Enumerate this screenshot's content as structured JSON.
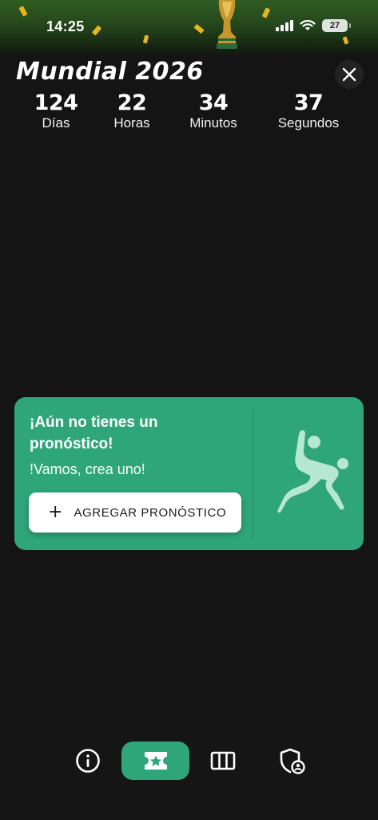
{
  "status_bar": {
    "time": "14:25",
    "battery": "27",
    "icons": [
      "signal-icon",
      "wifi-icon",
      "battery-icon"
    ]
  },
  "header": {
    "title": "Mundial 2026",
    "close_icon": "close-icon"
  },
  "countdown": {
    "days": {
      "value": "124",
      "label": "Días"
    },
    "hours": {
      "value": "22",
      "label": "Horas"
    },
    "minutes": {
      "value": "34",
      "label": "Minutos"
    },
    "seconds": {
      "value": "37",
      "label": "Segundos"
    }
  },
  "prediction_card": {
    "title": "¡Aún no tienes un pronóstico!",
    "subtitle": "!Vamos, crea uno!",
    "button_icon": "+",
    "button_label": "AGREGAR PRONÓSTICO",
    "illustration": "bicycle-kick-player-icon"
  },
  "bottom_nav": {
    "items": [
      {
        "icon": "info-icon",
        "active": false
      },
      {
        "icon": "ticket-star-icon",
        "active": true
      },
      {
        "icon": "columns-icon",
        "active": false
      },
      {
        "icon": "shield-user-icon",
        "active": false
      }
    ]
  },
  "colors": {
    "background": "#141414",
    "accent": "#2fa67a",
    "text": "#ffffff"
  }
}
